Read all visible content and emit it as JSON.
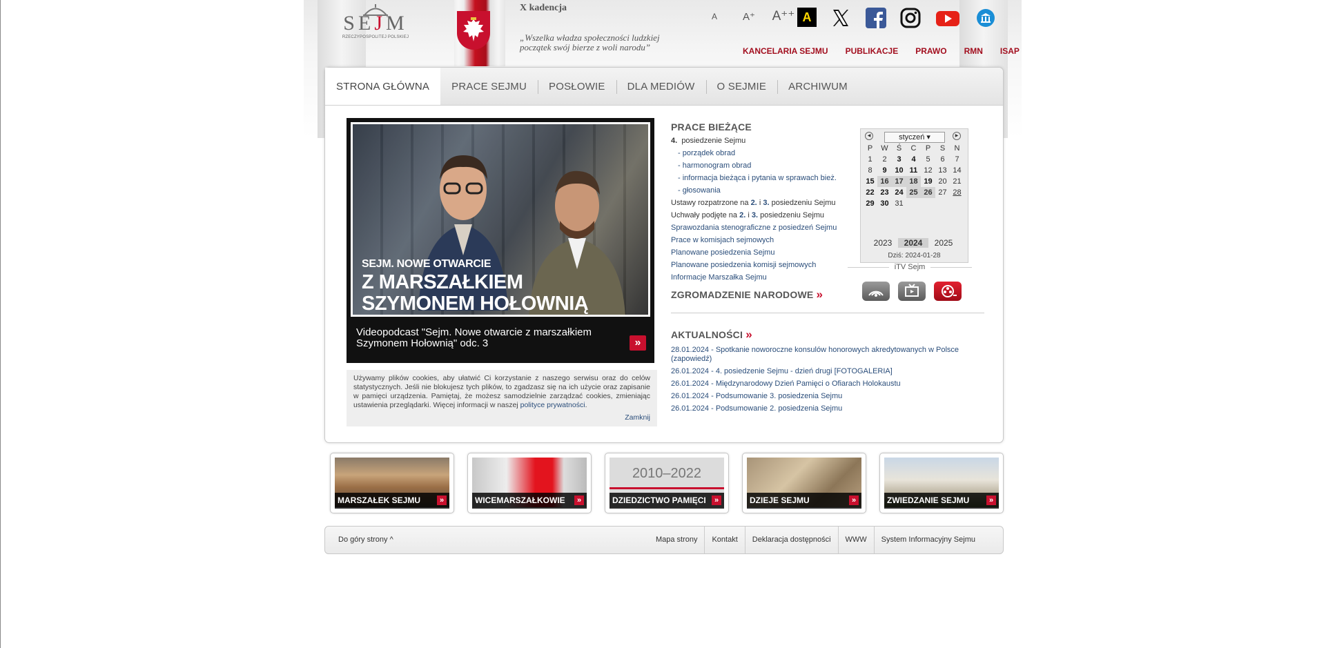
{
  "header": {
    "logo_text_left": "SE",
    "logo_text_mid": "J",
    "logo_text_right": "M",
    "logo_sub": "RZECZYPOSPOLITEJ POLSKIEJ",
    "term": "X kadencja",
    "motto": "„Wszelka władza społeczności ludzkiej początek swój bierze z woli narodu”",
    "font_small": "A",
    "font_medium": "A⁺",
    "font_large": "A⁺⁺",
    "contrast_label": "A",
    "links": [
      "KANCELARIA SEJMU",
      "PUBLIKACJE",
      "PRAWO",
      "RMN",
      "ISAP"
    ]
  },
  "social_icons": [
    "x-icon",
    "facebook-icon",
    "instagram-icon",
    "youtube-icon",
    "museum-icon"
  ],
  "nav": {
    "tabs": [
      "STRONA GŁÓWNA",
      "PRACE SEJMU",
      "POSŁOWIE",
      "DLA MEDIÓW",
      "O SEJMIE",
      "ARCHIWUM"
    ]
  },
  "video": {
    "title_small": "SEJM. NOWE OTWARCIE",
    "title_large_1": "Z MARSZAŁKIEM",
    "title_large_2": "SZYMONEM HOŁOWNIĄ",
    "caption": "Videopodcast \"Sejm. Nowe otwarcie z marszałkiem Szymonem Hołownią\" odc. 3",
    "more": "»"
  },
  "cookie": {
    "text": "Używamy plików cookies, aby ułatwić Ci korzystanie z naszego serwisu oraz do celów statystycznych. Jeśli nie blokujesz tych plików, to zgadzasz się na ich użycie oraz zapisanie w pamięci urządzenia. Pamiętaj, że możesz samodzielnie zarządzać cookies, zmieniając ustawienia przeglądarki. Więcej informacji w naszej",
    "link": "polityce prywatności",
    "close": "Zamknij"
  },
  "prace": {
    "heading": "PRACE BIEŻĄCE",
    "session_num": "4.",
    "session_label": "posiedzenie Sejmu",
    "sub": [
      "- porządek obrad",
      "- harmonogram obrad",
      "- informacja bieżąca i pytania w sprawach bież.",
      "- głosowania"
    ],
    "ustawy_pre": "Ustawy rozpatrzone na",
    "ustawy_n1": "2.",
    "and": "i",
    "ustawy_n2": "3.",
    "ustawy_post": "posiedzeniu Sejmu",
    "uchwaly_pre": "Uchwały podjęte na",
    "uchwaly_n1": "2.",
    "uchwaly_n2": "3.",
    "uchwaly_post": "posiedzeniu Sejmu",
    "links": [
      "Sprawozdania stenograficzne z posiedzeń Sejmu",
      "Prace w komisjach sejmowych",
      "Planowane posiedzenia Sejmu",
      "Planowane posiedzenia komisji sejmowych",
      "Informacje Marszałka Sejmu"
    ],
    "zgromadzenie": "ZGROMADZENIE NARODOWE",
    "arrow": "»"
  },
  "calendar": {
    "month": "styczeń",
    "days_header": [
      "P",
      "W",
      "Ś",
      "C",
      "P",
      "S",
      "N"
    ],
    "weeks": [
      [
        "1",
        "2",
        "3",
        "4",
        "5",
        "6",
        "7"
      ],
      [
        "8",
        "9",
        "10",
        "11",
        "12",
        "13",
        "14"
      ],
      [
        "15",
        "16",
        "17",
        "18",
        "19",
        "20",
        "21"
      ],
      [
        "22",
        "23",
        "24",
        "25",
        "26",
        "27",
        "28"
      ],
      [
        "29",
        "30",
        "31",
        "",
        "",
        "",
        ""
      ]
    ],
    "years": [
      "2023",
      "2024",
      "2025"
    ],
    "today": "Dziś: 2024-01-28"
  },
  "itv": {
    "label": "iTV Sejm"
  },
  "aktualnosci": {
    "heading": "AKTUALNOŚCI",
    "arrow": "»",
    "items": [
      "28.01.2024 - Spotkanie noworoczne konsulów honorowych akredytowanych w Polsce (zapowiedź)",
      "26.01.2024 - 4. posiedzenie Sejmu - dzień drugi [FOTOGALERIA]",
      "26.01.2024 - Międzynarodowy Dzień Pamięci o Ofiarach Holokaustu",
      "26.01.2024 - Podsumowanie 3. posiedzenia Sejmu",
      "26.01.2024 - Podsumowanie 2. posiedzenia Sejmu"
    ]
  },
  "tiles": [
    "MARSZAŁEK SEJMU",
    "WICEMARSZAŁKOWIE",
    "DZIEDZICTWO PAMIĘCI",
    "DZIEJE SEJMU",
    "ZWIEDZANIE SEJMU"
  ],
  "tile_dziedzictwo_years": "2010–2022",
  "tile_arrow": "»",
  "footer": {
    "up": "Do góry strony ^",
    "links": [
      "Mapa strony",
      "Kontakt",
      "Deklaracja dostępności",
      "WWW",
      "System Informacyjny Sejmu"
    ]
  },
  "colors": {
    "accent": "#c8102e",
    "link": "#2a4d7a",
    "header_link": "#a20e1e"
  }
}
